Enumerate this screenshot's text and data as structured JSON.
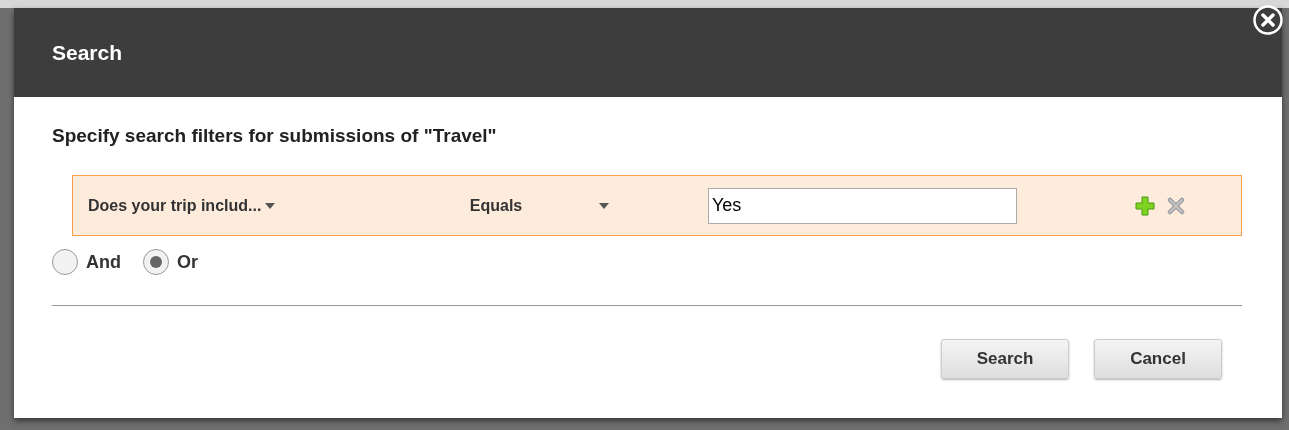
{
  "dialog": {
    "title": "Search",
    "heading": "Specify search filters for submissions of \"Travel\"",
    "filters": [
      {
        "field": "Does your trip includ...",
        "operator": "Equals",
        "value": "Yes"
      }
    ],
    "logic": [
      {
        "label": "And",
        "selected": false
      },
      {
        "label": "Or",
        "selected": true
      }
    ],
    "buttons": [
      {
        "label": "Search"
      },
      {
        "label": "Cancel"
      }
    ]
  }
}
